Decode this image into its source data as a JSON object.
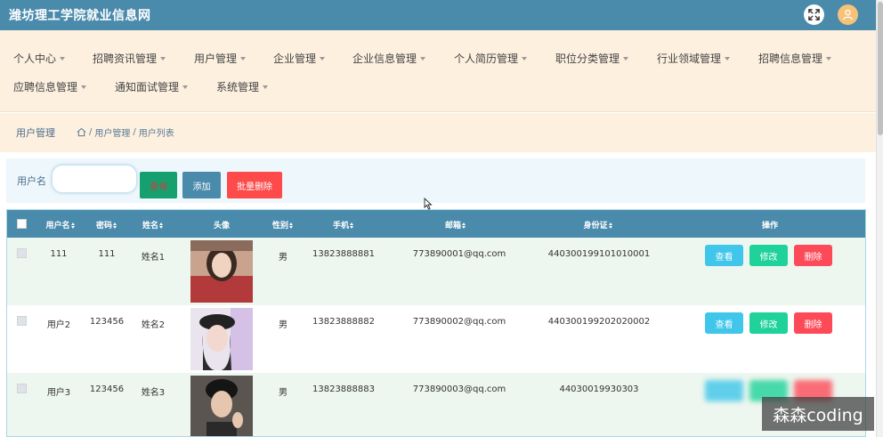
{
  "app": {
    "title": "潍坊理工学院就业信息网"
  },
  "nav": {
    "items": [
      {
        "label": "个人中心"
      },
      {
        "label": "招聘资讯管理"
      },
      {
        "label": "用户管理"
      },
      {
        "label": "企业管理"
      },
      {
        "label": "企业信息管理"
      },
      {
        "label": "个人简历管理"
      },
      {
        "label": "职位分类管理"
      },
      {
        "label": "行业领域管理"
      },
      {
        "label": "招聘信息管理"
      },
      {
        "label": "应聘信息管理"
      },
      {
        "label": "通知面试管理"
      },
      {
        "label": "系统管理"
      }
    ]
  },
  "breadcrumb": {
    "title": "用户管理",
    "sep": "/",
    "path": [
      "用户管理",
      "用户列表"
    ]
  },
  "search": {
    "label": "用户名",
    "value": "",
    "placeholder": "",
    "search_button": "查询",
    "add_button": "添加",
    "batch_delete_button": "批量删除"
  },
  "table": {
    "headers": [
      "用户名",
      "密码",
      "姓名",
      "头像",
      "性别",
      "手机",
      "邮箱",
      "身份证",
      "操作"
    ],
    "rows": [
      {
        "username": "111",
        "password": "111",
        "name": "姓名1",
        "gender": "男",
        "phone": "13823888881",
        "email": "773890001@qq.com",
        "id_card": "440300199101010001"
      },
      {
        "username": "用户2",
        "password": "123456",
        "name": "姓名2",
        "gender": "男",
        "phone": "13823888882",
        "email": "773890002@qq.com",
        "id_card": "440300199202020002"
      },
      {
        "username": "用户3",
        "password": "123456",
        "name": "姓名3",
        "gender": "男",
        "phone": "13823888883",
        "email": "773890003@qq.com",
        "id_card": "44030019930303"
      }
    ],
    "actions": {
      "view": "查看",
      "edit": "修改",
      "delete": "删除"
    }
  },
  "watermark": {
    "text": "森森coding"
  },
  "colors": {
    "topbar": "#4a8aab",
    "nav_bg": "#fdf0df",
    "view_btn": "#3fc6ea",
    "edit_btn": "#1fd29a",
    "delete_btn": "#fd4a58",
    "search_btn": "#16a070",
    "batch_delete_btn": "#fd4a4a"
  }
}
